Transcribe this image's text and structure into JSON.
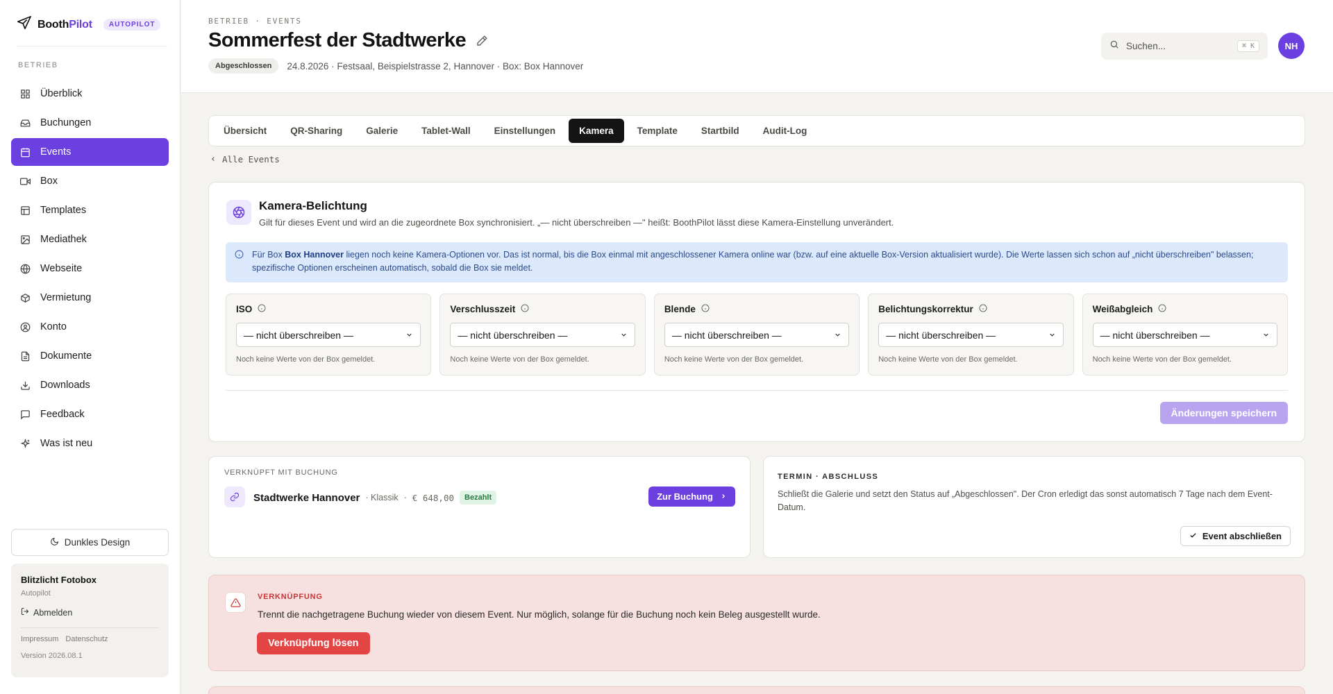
{
  "brand": {
    "name_part1": "Booth",
    "name_part2": "Pilot",
    "badge": "AUTOPILOT"
  },
  "sidebar": {
    "section": "BETRIEB",
    "items": [
      {
        "label": "Überblick",
        "icon": "dashboard-icon"
      },
      {
        "label": "Buchungen",
        "icon": "inbox-icon"
      },
      {
        "label": "Events",
        "icon": "calendar-icon",
        "active": true
      },
      {
        "label": "Box",
        "icon": "camera-icon"
      },
      {
        "label": "Templates",
        "icon": "template-icon"
      },
      {
        "label": "Mediathek",
        "icon": "image-icon"
      },
      {
        "label": "Webseite",
        "icon": "globe-icon"
      },
      {
        "label": "Vermietung",
        "icon": "package-icon"
      },
      {
        "label": "Konto",
        "icon": "user-icon"
      },
      {
        "label": "Dokumente",
        "icon": "document-icon"
      },
      {
        "label": "Downloads",
        "icon": "download-icon"
      },
      {
        "label": "Feedback",
        "icon": "message-icon"
      },
      {
        "label": "Was ist neu",
        "icon": "sparkle-icon"
      }
    ],
    "dark_mode_label": "Dunkles Design",
    "account": {
      "name": "Blitzlicht Fotobox",
      "plan": "Autopilot",
      "logout": "Abmelden",
      "impressum": "Impressum",
      "datenschutz": "Datenschutz",
      "version": "Version 2026.08.1"
    }
  },
  "header": {
    "breadcrumb": "BETRIEB · EVENTS",
    "title": "Sommerfest der Stadtwerke",
    "status": "Abgeschlossen",
    "meta": "24.8.2026 · Festsaal, Beispielstrasse 2, Hannover · Box: Box Hannover",
    "search_placeholder": "Suchen...",
    "search_shortcut": "⌘ K",
    "avatar_initials": "NH"
  },
  "tabs": [
    {
      "label": "Übersicht"
    },
    {
      "label": "QR-Sharing"
    },
    {
      "label": "Galerie"
    },
    {
      "label": "Tablet-Wall"
    },
    {
      "label": "Einstellungen"
    },
    {
      "label": "Kamera",
      "active": true
    },
    {
      "label": "Template"
    },
    {
      "label": "Startbild"
    },
    {
      "label": "Audit-Log"
    }
  ],
  "back_link": "Alle Events",
  "camera": {
    "title": "Kamera-Belichtung",
    "description": "Gilt für dieses Event und wird an die zugeordnete Box synchronisiert. „— nicht überschreiben —\" heißt: BoothPilot lässt diese Kamera-Einstellung unverändert.",
    "info_prefix": "Für Box ",
    "info_box_name": "Box Hannover",
    "info_suffix": " liegen noch keine Kamera-Optionen vor. Das ist normal, bis die Box einmal mit angeschlossener Kamera online war (bzw. auf eine aktuelle Box-Version aktualisiert wurde). Die Werte lassen sich schon auf „nicht überschreiben\" belassen; spezifische Optionen erscheinen automatisch, sobald die Box sie meldet.",
    "fields": [
      {
        "label": "ISO",
        "value": "— nicht überschreiben —",
        "hint": "Noch keine Werte von der Box gemeldet."
      },
      {
        "label": "Verschlusszeit",
        "value": "— nicht überschreiben —",
        "hint": "Noch keine Werte von der Box gemeldet."
      },
      {
        "label": "Blende",
        "value": "— nicht überschreiben —",
        "hint": "Noch keine Werte von der Box gemeldet."
      },
      {
        "label": "Belichtungskorrektur",
        "value": "— nicht überschreiben —",
        "hint": "Noch keine Werte von der Box gemeldet."
      },
      {
        "label": "Weißabgleich",
        "value": "— nicht überschreiben —",
        "hint": "Noch keine Werte von der Box gemeldet."
      }
    ],
    "save_label": "Änderungen speichern"
  },
  "linked": {
    "label": "VERKNÜPFT MIT BUCHUNG",
    "name": "Stadtwerke Hannover",
    "package": "· Klassik",
    "dot": "·",
    "price": "€ 648,00",
    "paid": "Bezahlt",
    "button": "Zur Buchung"
  },
  "termin": {
    "label": "TERMIN · ABSCHLUSS",
    "description": "Schließt die Galerie und setzt den Status auf „Abgeschlossen\". Der Cron erledigt das sonst automatisch 7 Tage nach dem Event-Datum.",
    "button": "Event abschließen"
  },
  "unlink": {
    "label": "VERKNÜPFUNG",
    "description": "Trennt die nachgetragene Buchung wieder von diesem Event. Nur möglich, solange für die Buchung noch kein Beleg ausgestellt wurde.",
    "button": "Verknüpfung lösen"
  },
  "colors": {
    "accent": "#6b3fe0",
    "danger": "#e34545",
    "info_bg": "#dce8fb",
    "paid": "#2a7a44"
  }
}
